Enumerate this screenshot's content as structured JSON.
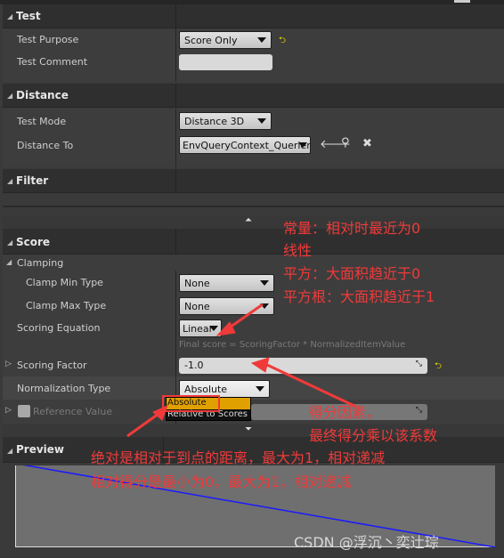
{
  "sections": {
    "test": "Test",
    "distance": "Distance",
    "filter": "Filter",
    "score": "Score",
    "preview": "Preview"
  },
  "test": {
    "purpose_label": "Test Purpose",
    "purpose_value": "Score Only",
    "comment_label": "Test Comment",
    "comment_value": ""
  },
  "distance": {
    "mode_label": "Test Mode",
    "mode_value": "Distance 3D",
    "to_label": "Distance To",
    "to_value": "EnvQueryContext_Querier"
  },
  "score": {
    "clamping": "Clamping",
    "clamp_min_label": "Clamp Min Type",
    "clamp_min_value": "None",
    "clamp_max_label": "Clamp Max Type",
    "clamp_max_value": "None",
    "equation_label": "Scoring Equation",
    "equation_value": "Linear",
    "formula": "Final score = ScoringFactor * NormalizedItemValue",
    "factor_label": "Scoring Factor",
    "factor_value": "-1.0",
    "norm_label": "Normalization Type",
    "norm_value": "Absolute",
    "norm_options": [
      "Absolute",
      "Relative to Scores"
    ],
    "ref_label": "Reference Value"
  },
  "annotations": {
    "a1": "常量：相对时最近为0",
    "a2": "线性",
    "a3": "平方：大面积趋近于0",
    "a4": "平方根：大面积趋近于1",
    "b1": "得分因素，",
    "b2": "最终得分乘以该系数",
    "c1": "绝对是相对于到点的距离，最大为1，相对递减",
    "c2": "相对得分是最小为0，最大为1，相对递减"
  },
  "watermark": "CSDN @浮沉丶奕辻琮",
  "colors": {
    "annotation": "#f03a3a",
    "highlight": "#e0a000",
    "curve": "#1a1aff"
  }
}
